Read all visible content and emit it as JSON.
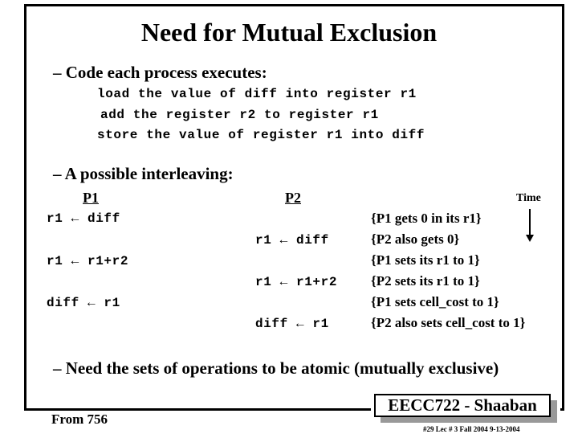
{
  "slide": {
    "title": "Need for Mutual Exclusion",
    "bullets": {
      "code_heading": "– Code each process executes:",
      "code_lines": [
        "load the value of diff into register r1",
        "add the register r2 to register r1",
        "store the value of register r1 into diff"
      ],
      "interleaving_heading": "– A possible interleaving:",
      "conclusion": "– Need the sets of operations to be atomic (mutually exclusive)"
    },
    "interleaving": {
      "p1_header": "P1",
      "p2_header": "P2",
      "time_label": "Time",
      "p1_steps": [
        "r1 ← diff",
        "r1 ← r1+r2",
        "diff ← r1"
      ],
      "p2_steps": [
        "r1 ← diff",
        "r1 ← r1+r2",
        "diff ← r1"
      ],
      "comments": [
        "{P1 gets 0 in its r1}",
        "{P2 also gets 0}",
        "{P1 sets its r1 to 1}",
        "{P2 sets its r1 to 1}",
        "{P1 sets cell_cost to 1}",
        "{P2 also sets cell_cost to 1}"
      ]
    },
    "footer": {
      "from": "From 756",
      "badge": "EECC722 - Shaaban",
      "meta": "#29   Lec # 3   Fall 2004  9-13-2004"
    }
  }
}
